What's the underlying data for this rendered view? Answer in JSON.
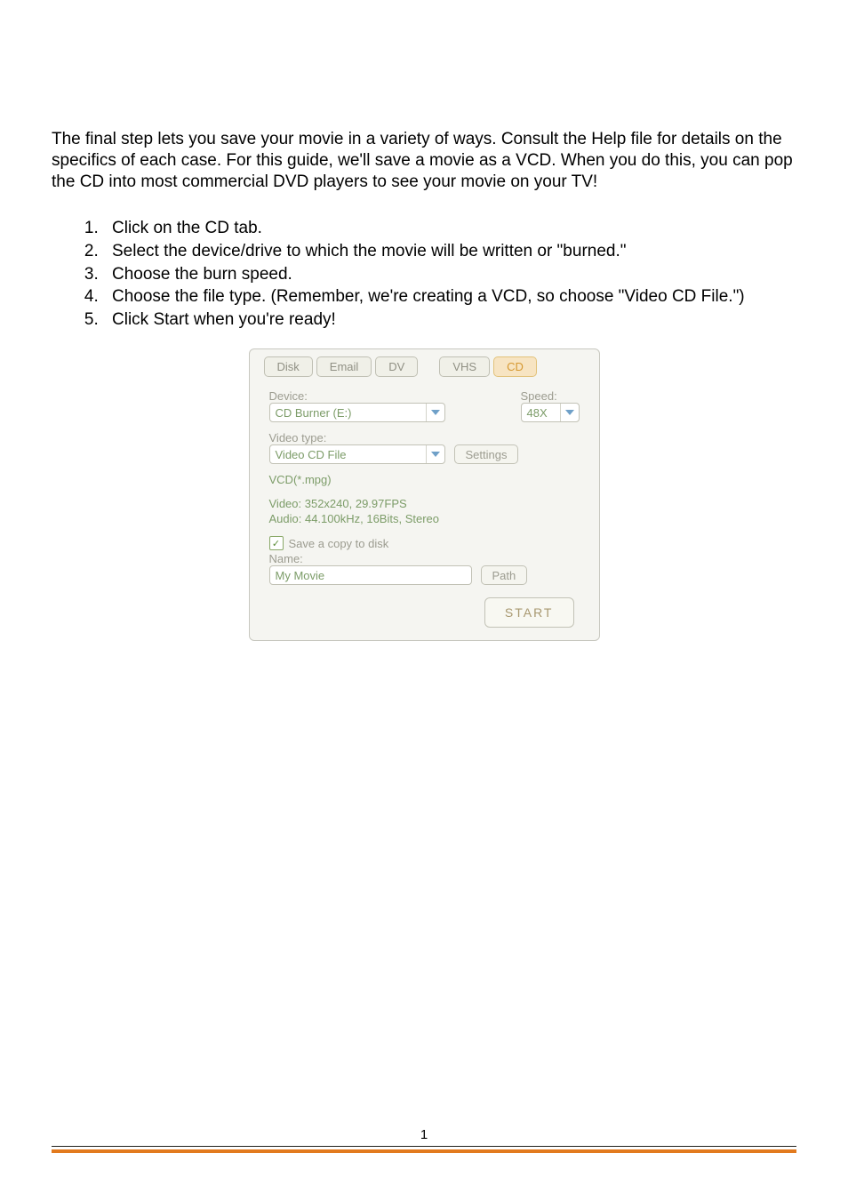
{
  "doc": {
    "intro": "The final step lets you save your movie in a variety of ways.  Consult the Help file for details on the specifics of each case.  For this guide, we'll save a movie as a VCD.  When you do this, you can pop the CD into most commercial DVD players to see your movie on your TV!",
    "steps": [
      "Click on the CD tab.",
      "Select the device/drive to which the movie will be written or \"burned.\"",
      "Choose the burn speed.",
      "Choose the file type.  (Remember, we're creating a VCD, so choose \"Video CD File.\")",
      "Click Start when you're ready!"
    ],
    "page_number": "1"
  },
  "panel": {
    "tabs": {
      "disk": "Disk",
      "email": "Email",
      "dv": "DV",
      "vhs": "VHS",
      "cd": "CD"
    },
    "device_label": "Device:",
    "device_value": "CD Burner (E:)",
    "speed_label": "Speed:",
    "speed_value": "48X",
    "video_type_label": "Video type:",
    "video_type_value": "Video CD File",
    "settings_btn": "Settings",
    "format_line": "VCD(*.mpg)",
    "video_info": "Video: 352x240, 29.97FPS",
    "audio_info": "Audio: 44.100kHz, 16Bits, Stereo",
    "save_copy_label": "Save a copy to disk",
    "name_label": "Name:",
    "name_value": "My Movie",
    "path_btn": "Path",
    "start_btn": "START"
  }
}
